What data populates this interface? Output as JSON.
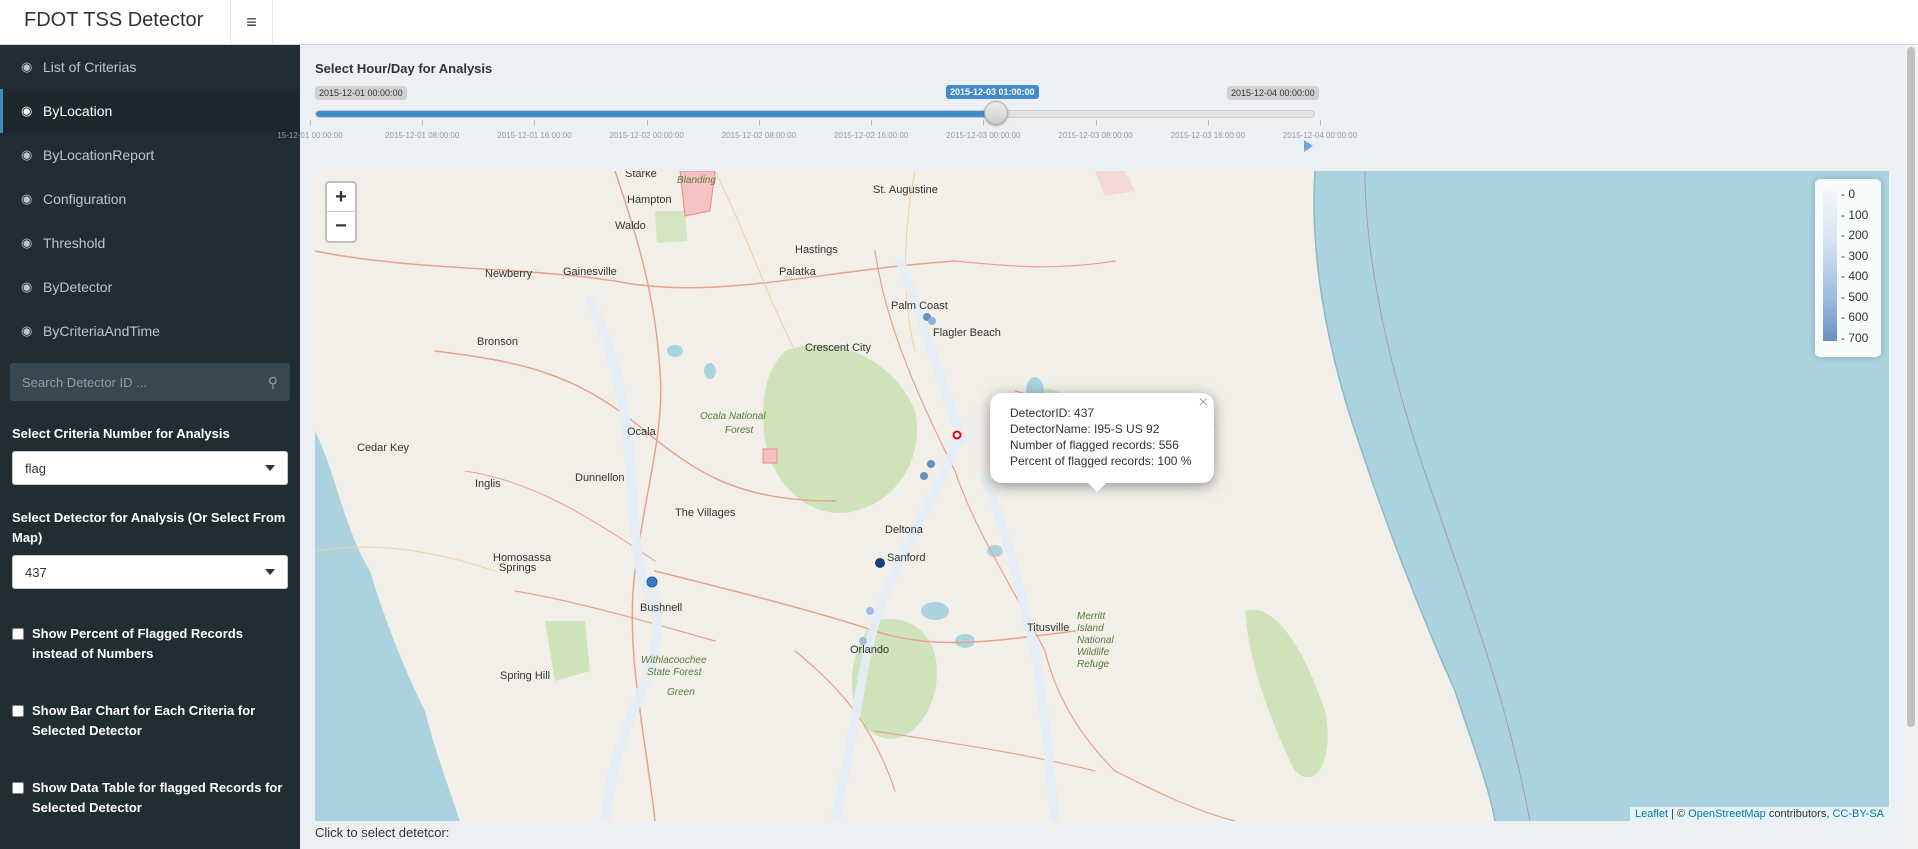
{
  "header": {
    "title": "FDOT TSS Detector"
  },
  "sidebar": {
    "items": [
      {
        "label": "List of Criterias"
      },
      {
        "label": "ByLocation"
      },
      {
        "label": "ByLocationReport"
      },
      {
        "label": "Configuration"
      },
      {
        "label": "Threshold"
      },
      {
        "label": "ByDetector"
      },
      {
        "label": "ByCriteriaAndTime"
      }
    ],
    "search_placeholder": "Search Detector ID ...",
    "criteria_label": "Select Criteria Number for Analysis",
    "criteria_value": "flag",
    "detector_label": "Select Detector for Analysis (Or Select From Map)",
    "detector_value": "437",
    "checkboxes": [
      {
        "label": "Show Percent of Flagged Records instead of Numbers"
      },
      {
        "label": "Show Bar Chart for Each Criteria for Selected Detector"
      },
      {
        "label": "Show Data Table for flagged Records for Selected Detector"
      }
    ]
  },
  "slider": {
    "label": "Select Hour/Day for Analysis",
    "min_label": "2015-12-01 00:00:00",
    "current_label": "2015-12-03 01:00:00",
    "max_label": "2015-12-04 00:00:00",
    "position_fraction": 0.681,
    "ticks": [
      "15-12-01 00:00:00",
      "2015-12-01 08:00:00",
      "2015-12-01 16:00:00",
      "2015-12-02 00:00:00",
      "2015-12-02 08:00:00",
      "2015-12-02 16:00:00",
      "2015-12-03 00:00:00",
      "2015-12-03 08:00:00",
      "2015-12-03 16:00:00",
      "2015-12-04 00:00:00"
    ]
  },
  "map": {
    "zoom_in": "+",
    "zoom_out": "−",
    "legend": [
      "0",
      "100",
      "200",
      "300",
      "400",
      "500",
      "600",
      "700"
    ],
    "legend_dash": "-",
    "popup": {
      "close": "×",
      "lines": [
        "DetectorID: 437",
        "DetectorName: I95-S US 92",
        "Number of flagged records: 556",
        "Percent of flagged records: 100 %"
      ]
    },
    "places": [
      "Starke",
      "Blanding",
      "St. Augustine",
      "Hampton",
      "Waldo",
      "Hastings",
      "Newberry",
      "Gainesville",
      "Palatka",
      "Palm Coast",
      "Flagler Beach",
      "Bronson",
      "Crescent City",
      "Ocala National Forest",
      "Ocala",
      "Cedar Key",
      "Dunnellon",
      "Inglis",
      "The Villages",
      "Deltona",
      "Sanford",
      "Homosassa Springs",
      "Bushnell",
      "Orlando",
      "Withlacoochee State Forest",
      "Spring Hill",
      "Green",
      "Titusville",
      "Merritt Island National Wildlife Refuge"
    ],
    "attribution": {
      "leaflet": "Leaflet",
      "sep": " | © ",
      "osm": "OpenStreetMap",
      "contrib": " contributors, ",
      "license": "CC-BY-SA"
    }
  },
  "footer": {
    "click_label": "Click to select detetcor:"
  },
  "colors": {
    "accent": "#3c8dbc",
    "sidebar": "#222d32",
    "slider_fill": "#428bca",
    "water": "#aad3df",
    "land": "#f2efe9"
  }
}
